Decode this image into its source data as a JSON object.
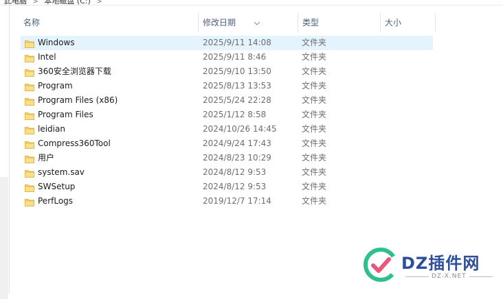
{
  "breadcrumb": {
    "items": [
      "此电脑",
      "本地磁盘 (C:)"
    ]
  },
  "columns": {
    "name": "名称",
    "date": "修改日期",
    "type": "类型",
    "size": "大小"
  },
  "rows": [
    {
      "name": "Windows",
      "date": "2025/9/11 14:08",
      "type": "文件夹",
      "size": ""
    },
    {
      "name": "Intel",
      "date": "2025/9/11 8:46",
      "type": "文件夹",
      "size": ""
    },
    {
      "name": "360安全浏览器下载",
      "date": "2025/9/10 13:50",
      "type": "文件夹",
      "size": ""
    },
    {
      "name": "Program",
      "date": "2025/8/13 13:53",
      "type": "文件夹",
      "size": ""
    },
    {
      "name": "Program Files (x86)",
      "date": "2025/5/24 22:28",
      "type": "文件夹",
      "size": ""
    },
    {
      "name": "Program Files",
      "date": "2025/1/12 8:58",
      "type": "文件夹",
      "size": ""
    },
    {
      "name": "leidian",
      "date": "2024/10/26 14:45",
      "type": "文件夹",
      "size": ""
    },
    {
      "name": "Compress360Tool",
      "date": "2024/9/24 17:43",
      "type": "文件夹",
      "size": ""
    },
    {
      "name": "用户",
      "date": "2024/8/23 10:29",
      "type": "文件夹",
      "size": ""
    },
    {
      "name": "system.sav",
      "date": "2024/8/12 9:53",
      "type": "文件夹",
      "size": ""
    },
    {
      "name": "SWSetup",
      "date": "2024/8/12 9:53",
      "type": "文件夹",
      "size": ""
    },
    {
      "name": "PerfLogs",
      "date": "2019/12/7 17:14",
      "type": "文件夹",
      "size": ""
    }
  ],
  "selected_row": 0,
  "watermark": {
    "title": "DZ插件网",
    "subtitle": "DZ-X.NET"
  },
  "colors": {
    "selected_bg": "#e5f3ff",
    "folder_yellow": "#f8d775",
    "header_text": "#4c607a"
  },
  "icons": {
    "folder": "folder-icon",
    "sort": "sort-arrow-icon",
    "breadcrumb_separator": "chevron-right-icon"
  }
}
